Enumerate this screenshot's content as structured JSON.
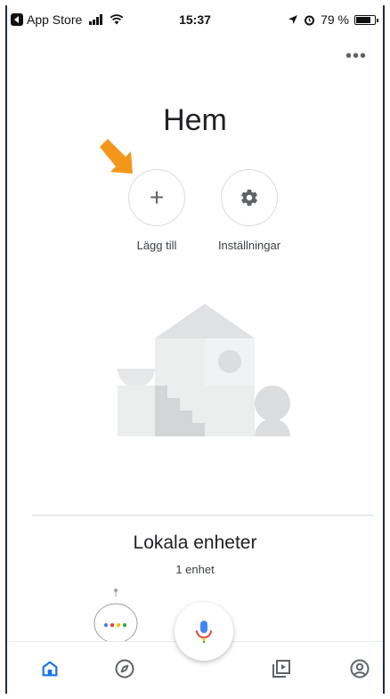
{
  "status_bar": {
    "back_app": "App Store",
    "time": "15:37",
    "battery": "79 %"
  },
  "page": {
    "title": "Hem",
    "more_label": "•••"
  },
  "actions": [
    {
      "label": "Lägg till",
      "icon": "plus-icon"
    },
    {
      "label": "Inställningar",
      "icon": "gear-icon"
    }
  ],
  "section": {
    "title": "Lokala enheter",
    "subtitle": "1 enhet"
  },
  "bottom_nav": {
    "items": [
      "home-icon",
      "discover-icon",
      "media-icon",
      "account-icon"
    ],
    "active": "home-icon"
  },
  "colors": {
    "accent": "#1a73e8",
    "arrow": "#f4961b",
    "icon_gray": "#5f6368",
    "divider": "#dadce0",
    "google_blue": "#4285f4",
    "google_red": "#ea4335",
    "google_yellow": "#fbbc05",
    "google_green": "#34a853"
  }
}
